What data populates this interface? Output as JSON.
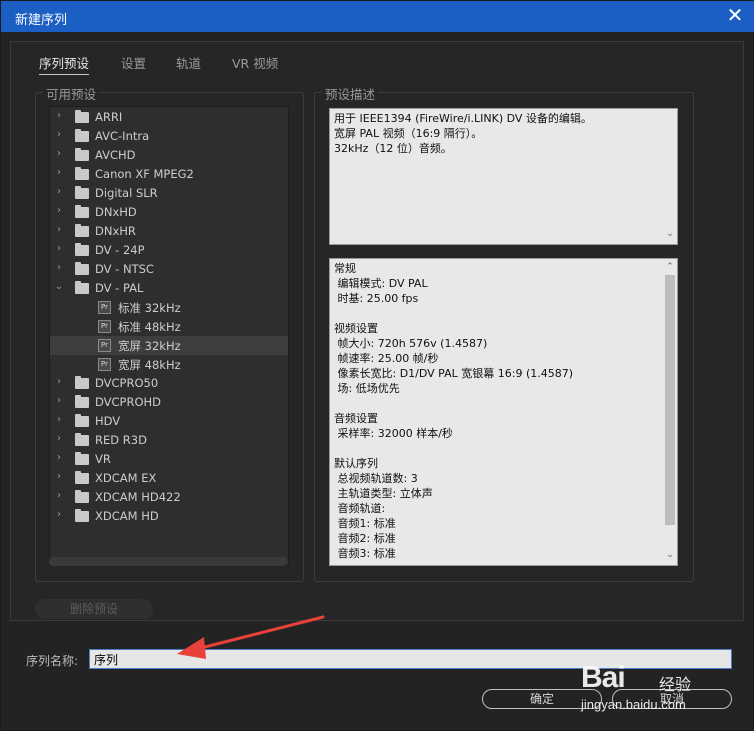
{
  "window": {
    "title": "新建序列",
    "close_glyph": "✕"
  },
  "tabs": [
    {
      "label": "序列预设",
      "active": true
    },
    {
      "label": "设置",
      "active": false
    },
    {
      "label": "轨道",
      "active": false
    },
    {
      "label": "VR 视频",
      "active": false
    }
  ],
  "presets": {
    "label": "可用预设",
    "tree": [
      {
        "label": "ARRI",
        "type": "folder",
        "expanded": false,
        "selected": false
      },
      {
        "label": "AVC-Intra",
        "type": "folder",
        "expanded": false,
        "selected": false
      },
      {
        "label": "AVCHD",
        "type": "folder",
        "expanded": false,
        "selected": false
      },
      {
        "label": "Canon XF MPEG2",
        "type": "folder",
        "expanded": false,
        "selected": false
      },
      {
        "label": "Digital SLR",
        "type": "folder",
        "expanded": false,
        "selected": false
      },
      {
        "label": "DNxHD",
        "type": "folder",
        "expanded": false,
        "selected": false
      },
      {
        "label": "DNxHR",
        "type": "folder",
        "expanded": false,
        "selected": false
      },
      {
        "label": "DV - 24P",
        "type": "folder",
        "expanded": false,
        "selected": false
      },
      {
        "label": "DV - NTSC",
        "type": "folder",
        "expanded": false,
        "selected": false
      },
      {
        "label": "DV - PAL",
        "type": "folder",
        "expanded": true,
        "selected": false
      },
      {
        "label": "标准 32kHz",
        "type": "preset",
        "selected": false
      },
      {
        "label": "标准 48kHz",
        "type": "preset",
        "selected": false
      },
      {
        "label": "宽屏 32kHz",
        "type": "preset",
        "selected": true
      },
      {
        "label": "宽屏 48kHz",
        "type": "preset",
        "selected": false
      },
      {
        "label": "DVCPRO50",
        "type": "folder",
        "expanded": false,
        "selected": false
      },
      {
        "label": "DVCPROHD",
        "type": "folder",
        "expanded": false,
        "selected": false
      },
      {
        "label": "HDV",
        "type": "folder",
        "expanded": false,
        "selected": false
      },
      {
        "label": "RED R3D",
        "type": "folder",
        "expanded": false,
        "selected": false
      },
      {
        "label": "VR",
        "type": "folder",
        "expanded": false,
        "selected": false
      },
      {
        "label": "XDCAM EX",
        "type": "folder",
        "expanded": false,
        "selected": false
      },
      {
        "label": "XDCAM HD422",
        "type": "folder",
        "expanded": false,
        "selected": false
      },
      {
        "label": "XDCAM HD",
        "type": "folder",
        "expanded": false,
        "selected": false
      }
    ]
  },
  "description": {
    "label": "预设描述",
    "summary_lines": [
      "用于 IEEE1394 (FireWire/i.LINK) DV 设备的编辑。",
      "宽屏 PAL 视频（16:9 隔行）。",
      "32kHz（12 位）音频。"
    ],
    "details_lines": [
      "常规",
      " 编辑模式: DV PAL",
      " 时基: 25.00 fps",
      "",
      "视频设置",
      " 帧大小: 720h 576v (1.4587)",
      " 帧速率: 25.00 帧/秒",
      " 像素长宽比: D1/DV PAL 宽银幕 16:9 (1.4587)",
      " 场: 低场优先",
      "",
      "音频设置",
      " 采样率: 32000 样本/秒",
      "",
      "默认序列",
      " 总视频轨道数: 3",
      " 主轨道类型: 立体声",
      " 音频轨道:",
      " 音频1: 标准",
      " 音频2: 标准",
      " 音频3: 标准"
    ]
  },
  "delete_button": "删除预设",
  "sequence_name": {
    "label": "序列名称:",
    "value": "序列"
  },
  "buttons": {
    "ok": "确定",
    "cancel": "取消"
  },
  "watermark": {
    "brand": "Bai",
    "brand_suffix": "经验",
    "url": "jingyan.baidu.com"
  },
  "colors": {
    "titlebar": "#1b5fc4",
    "annotation_arrow": "#e8403a"
  },
  "icons": {
    "folder": "folder-icon",
    "preset": "premiere-preset-icon",
    "expand": "chevron-right-icon",
    "collapse": "chevron-down-icon"
  }
}
